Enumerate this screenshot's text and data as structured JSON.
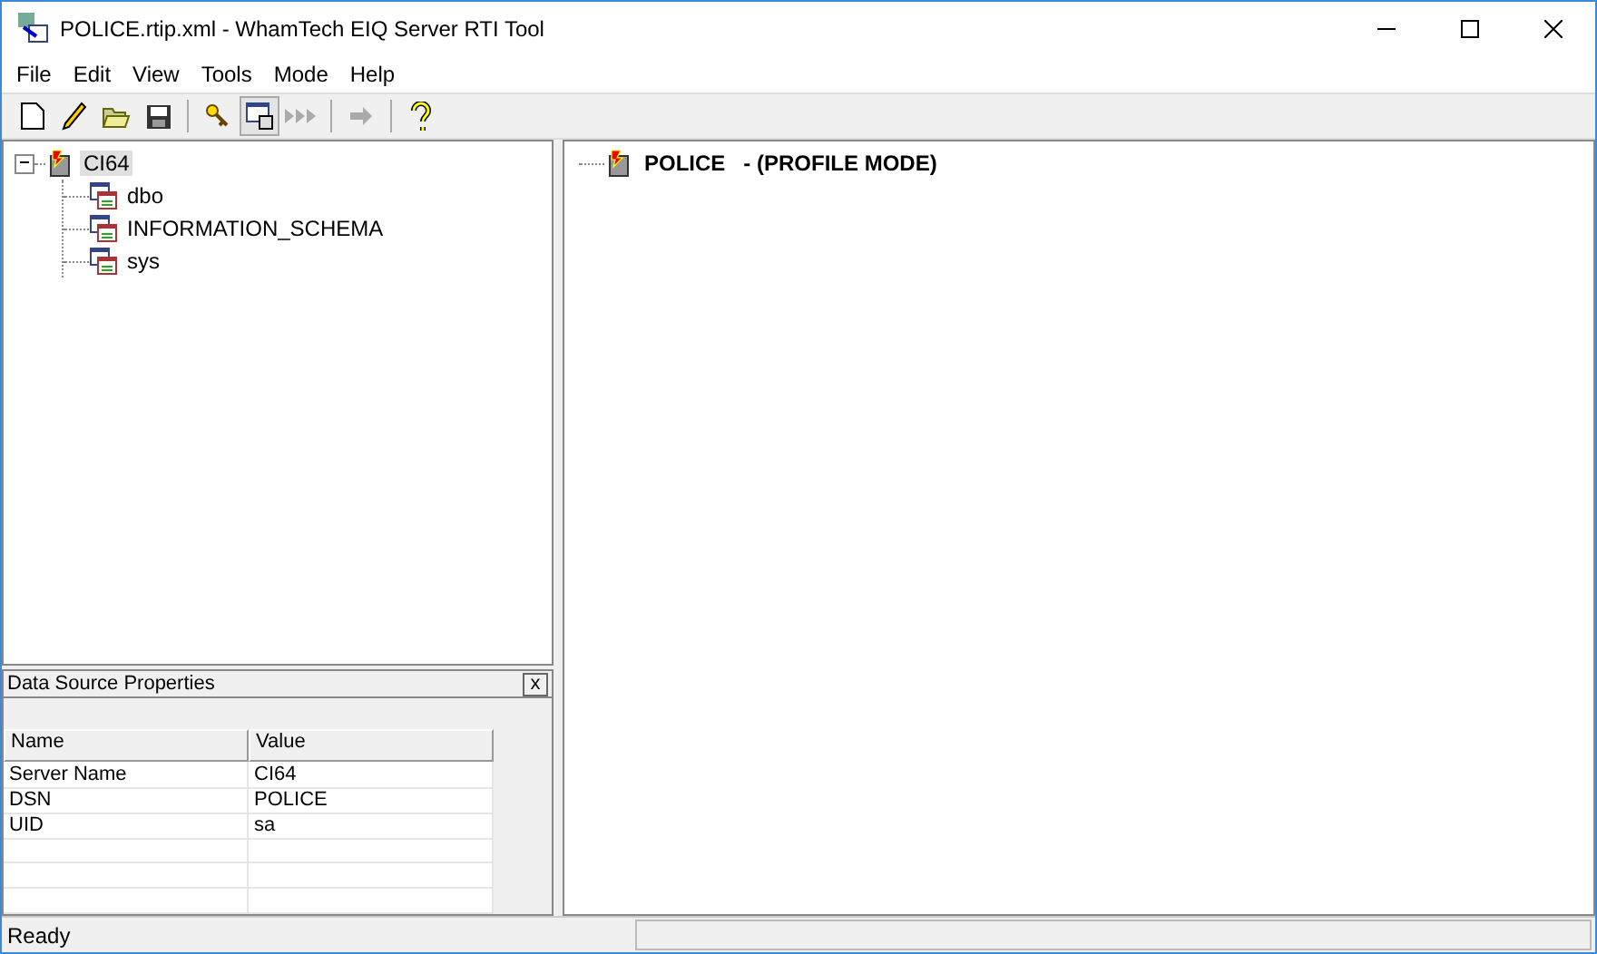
{
  "window": {
    "title": "POLICE.rtip.xml - WhamTech EIQ Server RTI Tool"
  },
  "menu": [
    "File",
    "Edit",
    "View",
    "Tools",
    "Mode",
    "Help"
  ],
  "toolbar": [
    {
      "kind": "new",
      "pressed": false
    },
    {
      "kind": "edit",
      "pressed": false
    },
    {
      "kind": "open",
      "pressed": false
    },
    {
      "kind": "save",
      "pressed": false
    },
    {
      "kind": "separator"
    },
    {
      "kind": "key",
      "pressed": false
    },
    {
      "kind": "view",
      "pressed": true
    },
    {
      "kind": "run",
      "pressed": false,
      "disabled": true
    },
    {
      "kind": "separator"
    },
    {
      "kind": "step",
      "pressed": false,
      "disabled": true
    },
    {
      "kind": "separator"
    },
    {
      "kind": "help",
      "pressed": false
    }
  ],
  "tree": [
    {
      "label": "CI64",
      "kind": "server",
      "selected": true,
      "expanded": true,
      "children": [
        {
          "label": "dbo",
          "kind": "schema",
          "selected": false
        },
        {
          "label": "INFORMATION_SCHEMA",
          "kind": "schema",
          "selected": false
        },
        {
          "label": "sys",
          "kind": "schema",
          "selected": false
        }
      ]
    }
  ],
  "properties": {
    "title": "Data Source Properties",
    "close": "x",
    "columns": [
      "Name",
      "Value"
    ],
    "rows": [
      [
        "Server Name",
        "CI64"
      ],
      [
        "DSN",
        "POLICE"
      ],
      [
        "UID",
        "sa"
      ]
    ]
  },
  "detail": {
    "name": "POLICE",
    "mode": "- (PROFILE MODE)"
  },
  "status_bar": "Ready"
}
